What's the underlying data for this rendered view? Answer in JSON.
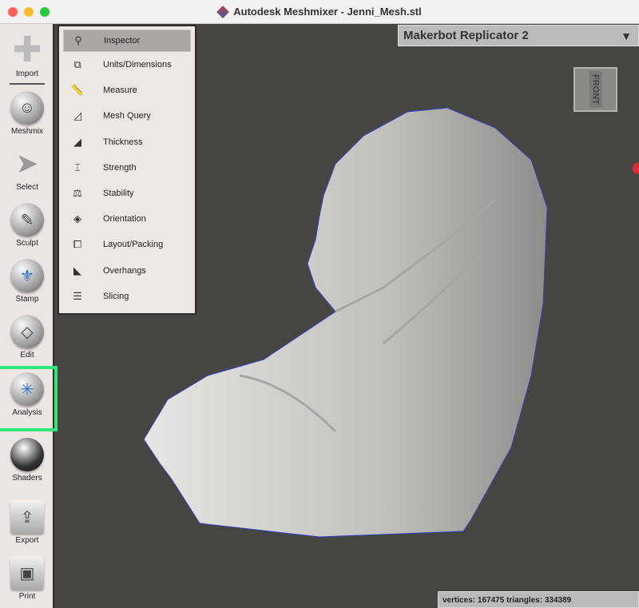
{
  "window": {
    "title": "Autodesk Meshmixer - Jenni_Mesh.stl"
  },
  "sidebar": {
    "items": [
      {
        "label": "Import",
        "icon": "plus-icon"
      },
      {
        "label": "Meshmix",
        "icon": "face-sphere-icon"
      },
      {
        "label": "Select",
        "icon": "arrow-cursor-icon"
      },
      {
        "label": "Sculpt",
        "icon": "brush-icon"
      },
      {
        "label": "Stamp",
        "icon": "stamp-icon"
      },
      {
        "label": "Edit",
        "icon": "edit-mesh-icon"
      },
      {
        "label": "Analysis",
        "icon": "analysis-icon",
        "highlighted": true
      },
      {
        "label": "Shaders",
        "icon": "shader-sphere-icon"
      },
      {
        "label": "Export",
        "icon": "export-icon"
      },
      {
        "label": "Print",
        "icon": "printer-icon"
      }
    ]
  },
  "analysis_menu": {
    "items": [
      {
        "label": "Inspector",
        "icon": "magnifier-icon",
        "selected": true
      },
      {
        "label": "Units/Dimensions",
        "icon": "units-icon"
      },
      {
        "label": "Measure",
        "icon": "ruler-icon"
      },
      {
        "label": "Mesh Query",
        "icon": "mesh-query-icon"
      },
      {
        "label": "Thickness",
        "icon": "thickness-icon"
      },
      {
        "label": "Strength",
        "icon": "strength-icon"
      },
      {
        "label": "Stability",
        "icon": "stability-icon"
      },
      {
        "label": "Orientation",
        "icon": "orientation-icon"
      },
      {
        "label": "Layout/Packing",
        "icon": "layout-icon"
      },
      {
        "label": "Overhangs",
        "icon": "overhangs-icon"
      },
      {
        "label": "Slicing",
        "icon": "slicing-icon"
      }
    ]
  },
  "printer": {
    "selected": "Makerbot Replicator 2"
  },
  "view_cube": {
    "face": "FRONT"
  },
  "status": {
    "text": "vertices: 167475 triangles: 334389"
  },
  "colors": {
    "viewport": "#474541",
    "highlight": "#2ee87a",
    "mesh": "#c9c7c4"
  }
}
